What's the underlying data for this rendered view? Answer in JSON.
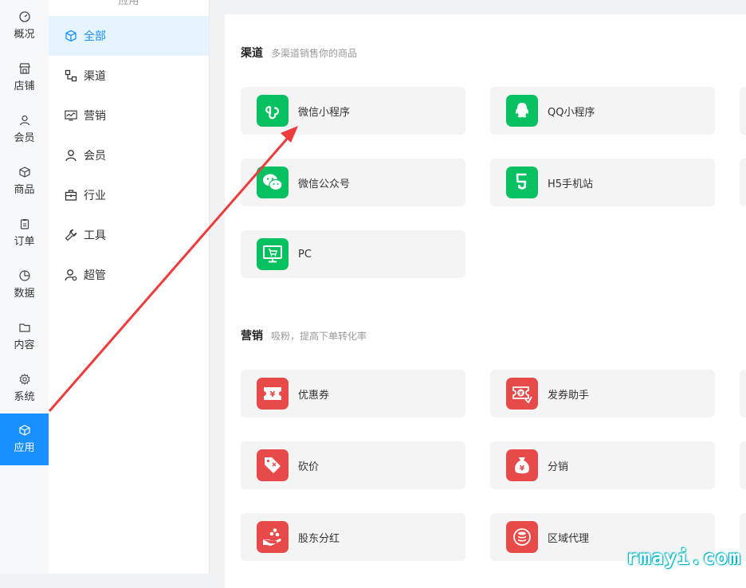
{
  "left_nav": {
    "items": [
      {
        "label": "概况",
        "icon": "dashboard-icon"
      },
      {
        "label": "店铺",
        "icon": "store-icon"
      },
      {
        "label": "会员",
        "icon": "user-icon"
      },
      {
        "label": "商品",
        "icon": "cube-icon"
      },
      {
        "label": "订单",
        "icon": "clipboard-icon"
      },
      {
        "label": "数据",
        "icon": "pie-chart-icon"
      },
      {
        "label": "内容",
        "icon": "folder-icon"
      },
      {
        "label": "系统",
        "icon": "gear-icon"
      },
      {
        "label": "应用",
        "icon": "cube-icon",
        "active": true
      }
    ],
    "active_color": "#1890ff"
  },
  "sub_nav": {
    "header": "应用",
    "items": [
      {
        "label": "全部",
        "icon": "cube-icon",
        "active": true
      },
      {
        "label": "渠道",
        "icon": "channel-icon"
      },
      {
        "label": "营销",
        "icon": "monitor-chart-icon"
      },
      {
        "label": "会员",
        "icon": "user-icon"
      },
      {
        "label": "行业",
        "icon": "briefcase-icon"
      },
      {
        "label": "工具",
        "icon": "wrench-icon"
      },
      {
        "label": "超管",
        "icon": "admin-user-icon"
      }
    ]
  },
  "sections": {
    "channel": {
      "title": "渠道",
      "desc": "多渠道销售你的商品",
      "cards": [
        {
          "label": "微信小程序",
          "icon": "mini-program-icon",
          "color": "#07c160"
        },
        {
          "label": "QQ小程序",
          "icon": "qq-penguin-icon",
          "color": "#07c160"
        },
        {
          "label": "微信公众号",
          "icon": "wechat-icon",
          "color": "#07c160"
        },
        {
          "label": "H5手机站",
          "icon": "html5-icon",
          "color": "#07c160"
        },
        {
          "label": "PC",
          "icon": "pc-monitor-icon",
          "color": "#07c160"
        }
      ]
    },
    "marketing": {
      "title": "营销",
      "desc": "吸粉，提高下单转化率",
      "cards": [
        {
          "label": "优惠券",
          "icon": "coupon-icon",
          "color": "#e84a4a"
        },
        {
          "label": "发券助手",
          "icon": "coupon-helper-icon",
          "color": "#e84a4a"
        },
        {
          "label": "砍价",
          "icon": "bargain-tag-icon",
          "color": "#e84a4a"
        },
        {
          "label": "分销",
          "icon": "money-bag-icon",
          "color": "#e84a4a"
        },
        {
          "label": "股东分红",
          "icon": "dividend-hand-icon",
          "color": "#e84a4a"
        },
        {
          "label": "区域代理",
          "icon": "coin-stack-icon",
          "color": "#e84a4a"
        }
      ]
    }
  },
  "watermark": "rmayi.com"
}
